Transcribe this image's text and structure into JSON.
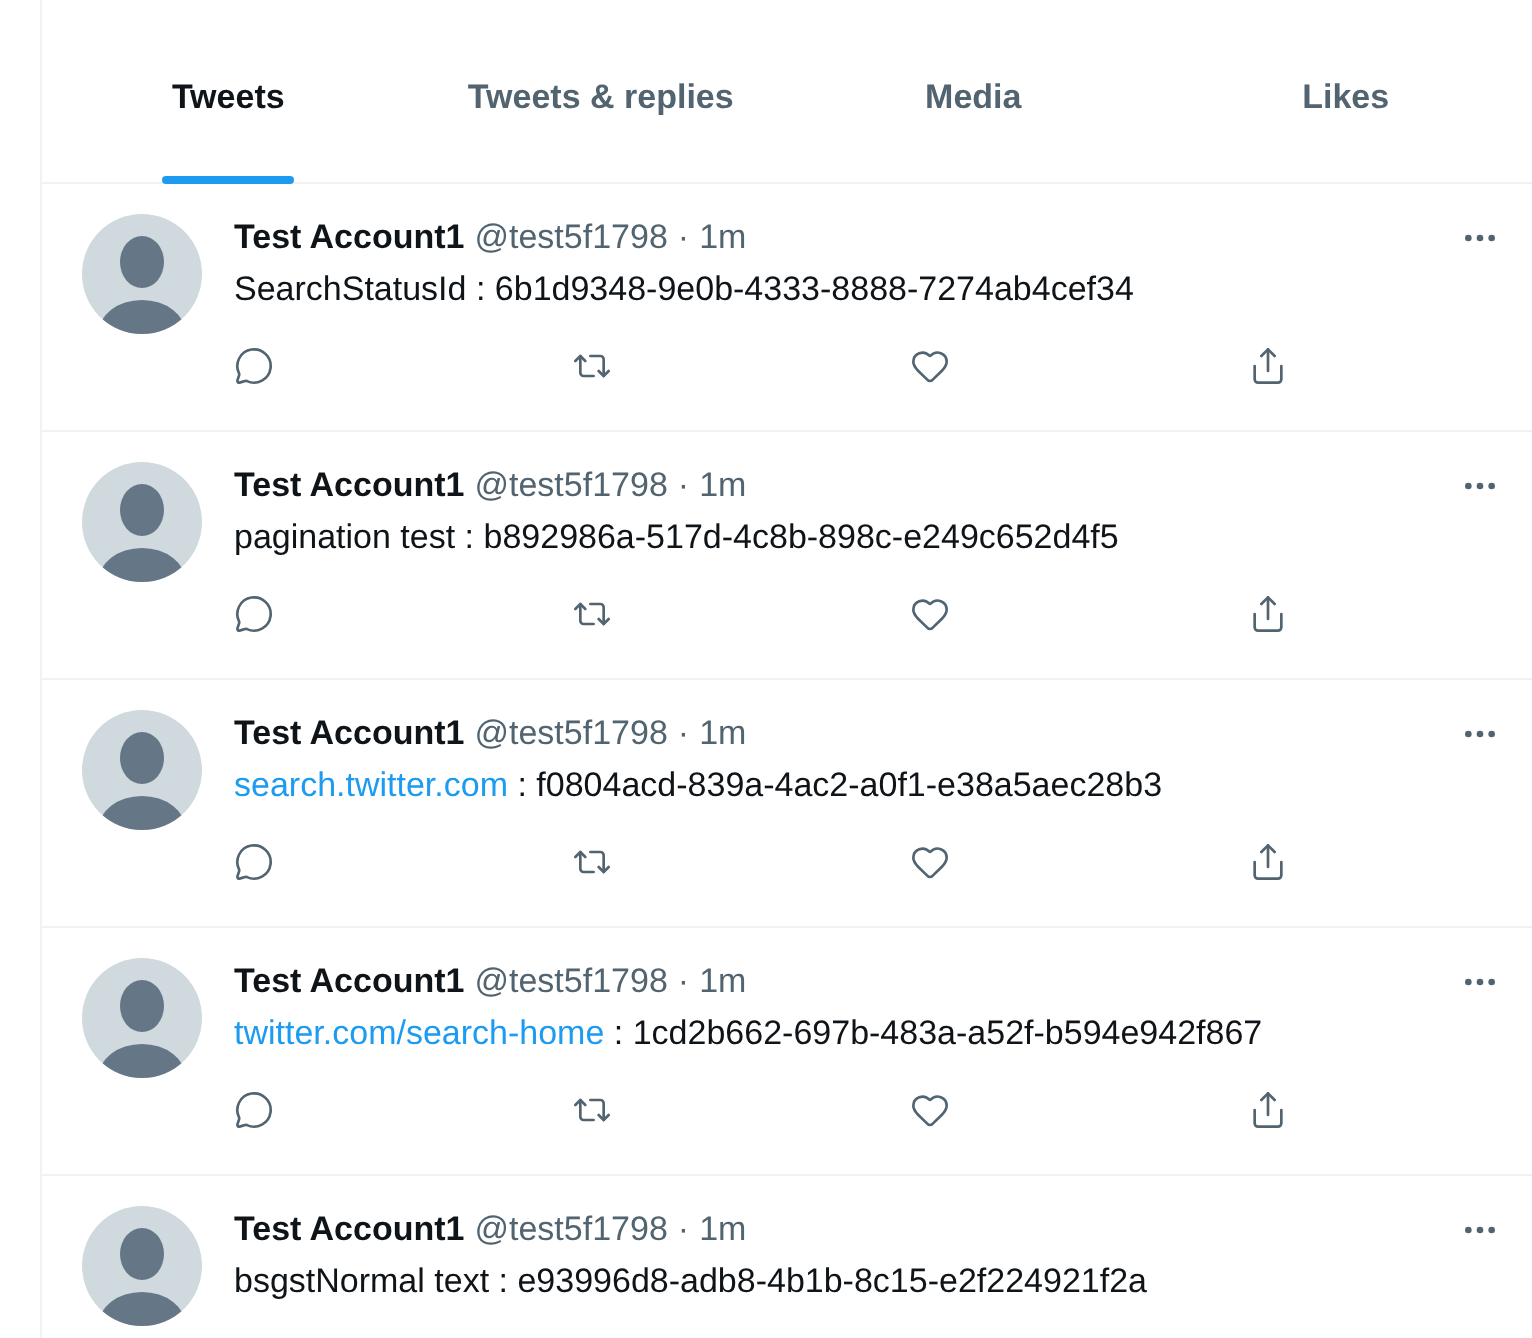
{
  "tabs": [
    {
      "label": "Tweets",
      "selected": true
    },
    {
      "label": "Tweets & replies",
      "selected": false
    },
    {
      "label": "Media",
      "selected": false
    },
    {
      "label": "Likes",
      "selected": false
    }
  ],
  "tweets": [
    {
      "name": "Test Account1",
      "handle": "@test5f1798",
      "separator": "·",
      "time": "1m",
      "text": "SearchStatusId : 6b1d9348-9e0b-4333-8888-7274ab4cef34"
    },
    {
      "name": "Test Account1",
      "handle": "@test5f1798",
      "separator": "·",
      "time": "1m",
      "text": "pagination test : b892986a-517d-4c8b-898c-e249c652d4f5"
    },
    {
      "name": "Test Account1",
      "handle": "@test5f1798",
      "separator": "·",
      "time": "1m",
      "link": "search.twitter.com",
      "text": " : f0804acd-839a-4ac2-a0f1-e38a5aec28b3"
    },
    {
      "name": "Test Account1",
      "handle": "@test5f1798",
      "separator": "·",
      "time": "1m",
      "link": "twitter.com/search-home",
      "text": " : 1cd2b662-697b-483a-a52f-b594e942f867"
    },
    {
      "name": "Test Account1",
      "handle": "@test5f1798",
      "separator": "·",
      "time": "1m",
      "text": "bsgstNormal text : e93996d8-adb8-4b1b-8c15-e2f224921f2a"
    }
  ]
}
